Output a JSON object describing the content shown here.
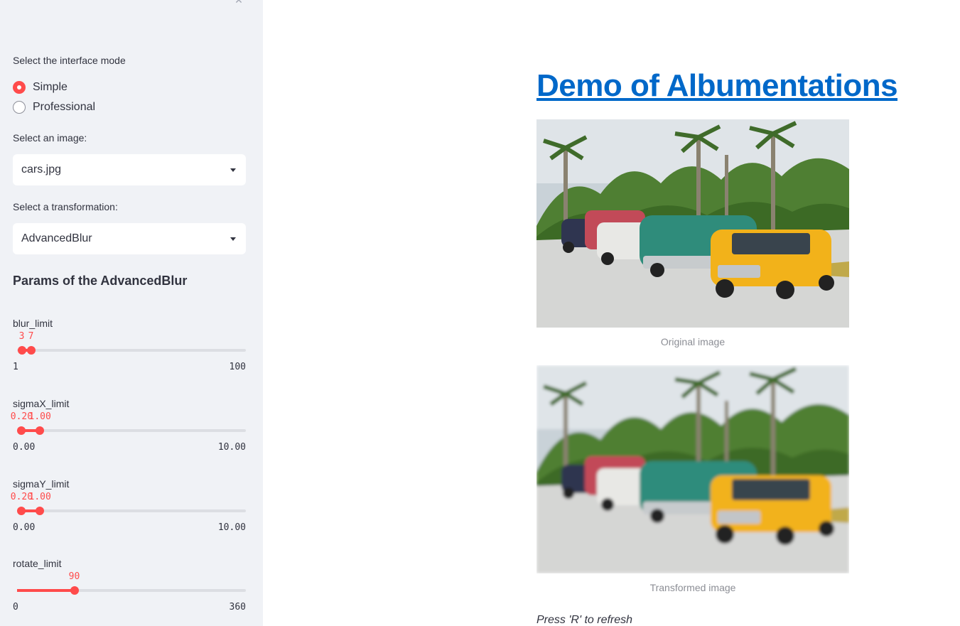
{
  "sidebar": {
    "mode": {
      "label": "Select the interface mode",
      "options": [
        {
          "label": "Simple",
          "selected": true
        },
        {
          "label": "Professional",
          "selected": false
        }
      ]
    },
    "image_select": {
      "label": "Select an image:",
      "value": "cars.jpg"
    },
    "transform_select": {
      "label": "Select a transformation:",
      "value": "AdvancedBlur"
    },
    "params_title": "Params of the AdvancedBlur",
    "sliders": [
      {
        "label": "blur_limit",
        "min": 1,
        "max": 100,
        "values": [
          3,
          7
        ],
        "min_text": "1",
        "max_text": "100",
        "value_texts": [
          "3",
          "7"
        ]
      },
      {
        "label": "sigmaX_limit",
        "min": 0,
        "max": 10,
        "values": [
          0.2,
          1.0
        ],
        "min_text": "0.00",
        "max_text": "10.00",
        "value_texts": [
          "0.20",
          "1.00"
        ]
      },
      {
        "label": "sigmaY_limit",
        "min": 0,
        "max": 10,
        "values": [
          0.2,
          1.0
        ],
        "min_text": "0.00",
        "max_text": "10.00",
        "value_texts": [
          "0.20",
          "1.00"
        ]
      },
      {
        "label": "rotate_limit",
        "min": 0,
        "max": 360,
        "values": [
          90
        ],
        "min_text": "0",
        "max_text": "360",
        "value_texts": [
          "90"
        ]
      }
    ],
    "accent_color": "#ff4b4b",
    "collapse_icon": "close-icon"
  },
  "main": {
    "title": "Demo of Albumentations",
    "title_color": "#0068c9",
    "original_caption": "Original image",
    "transformed_caption": "Transformed image",
    "hint": "Press 'R' to refresh"
  }
}
